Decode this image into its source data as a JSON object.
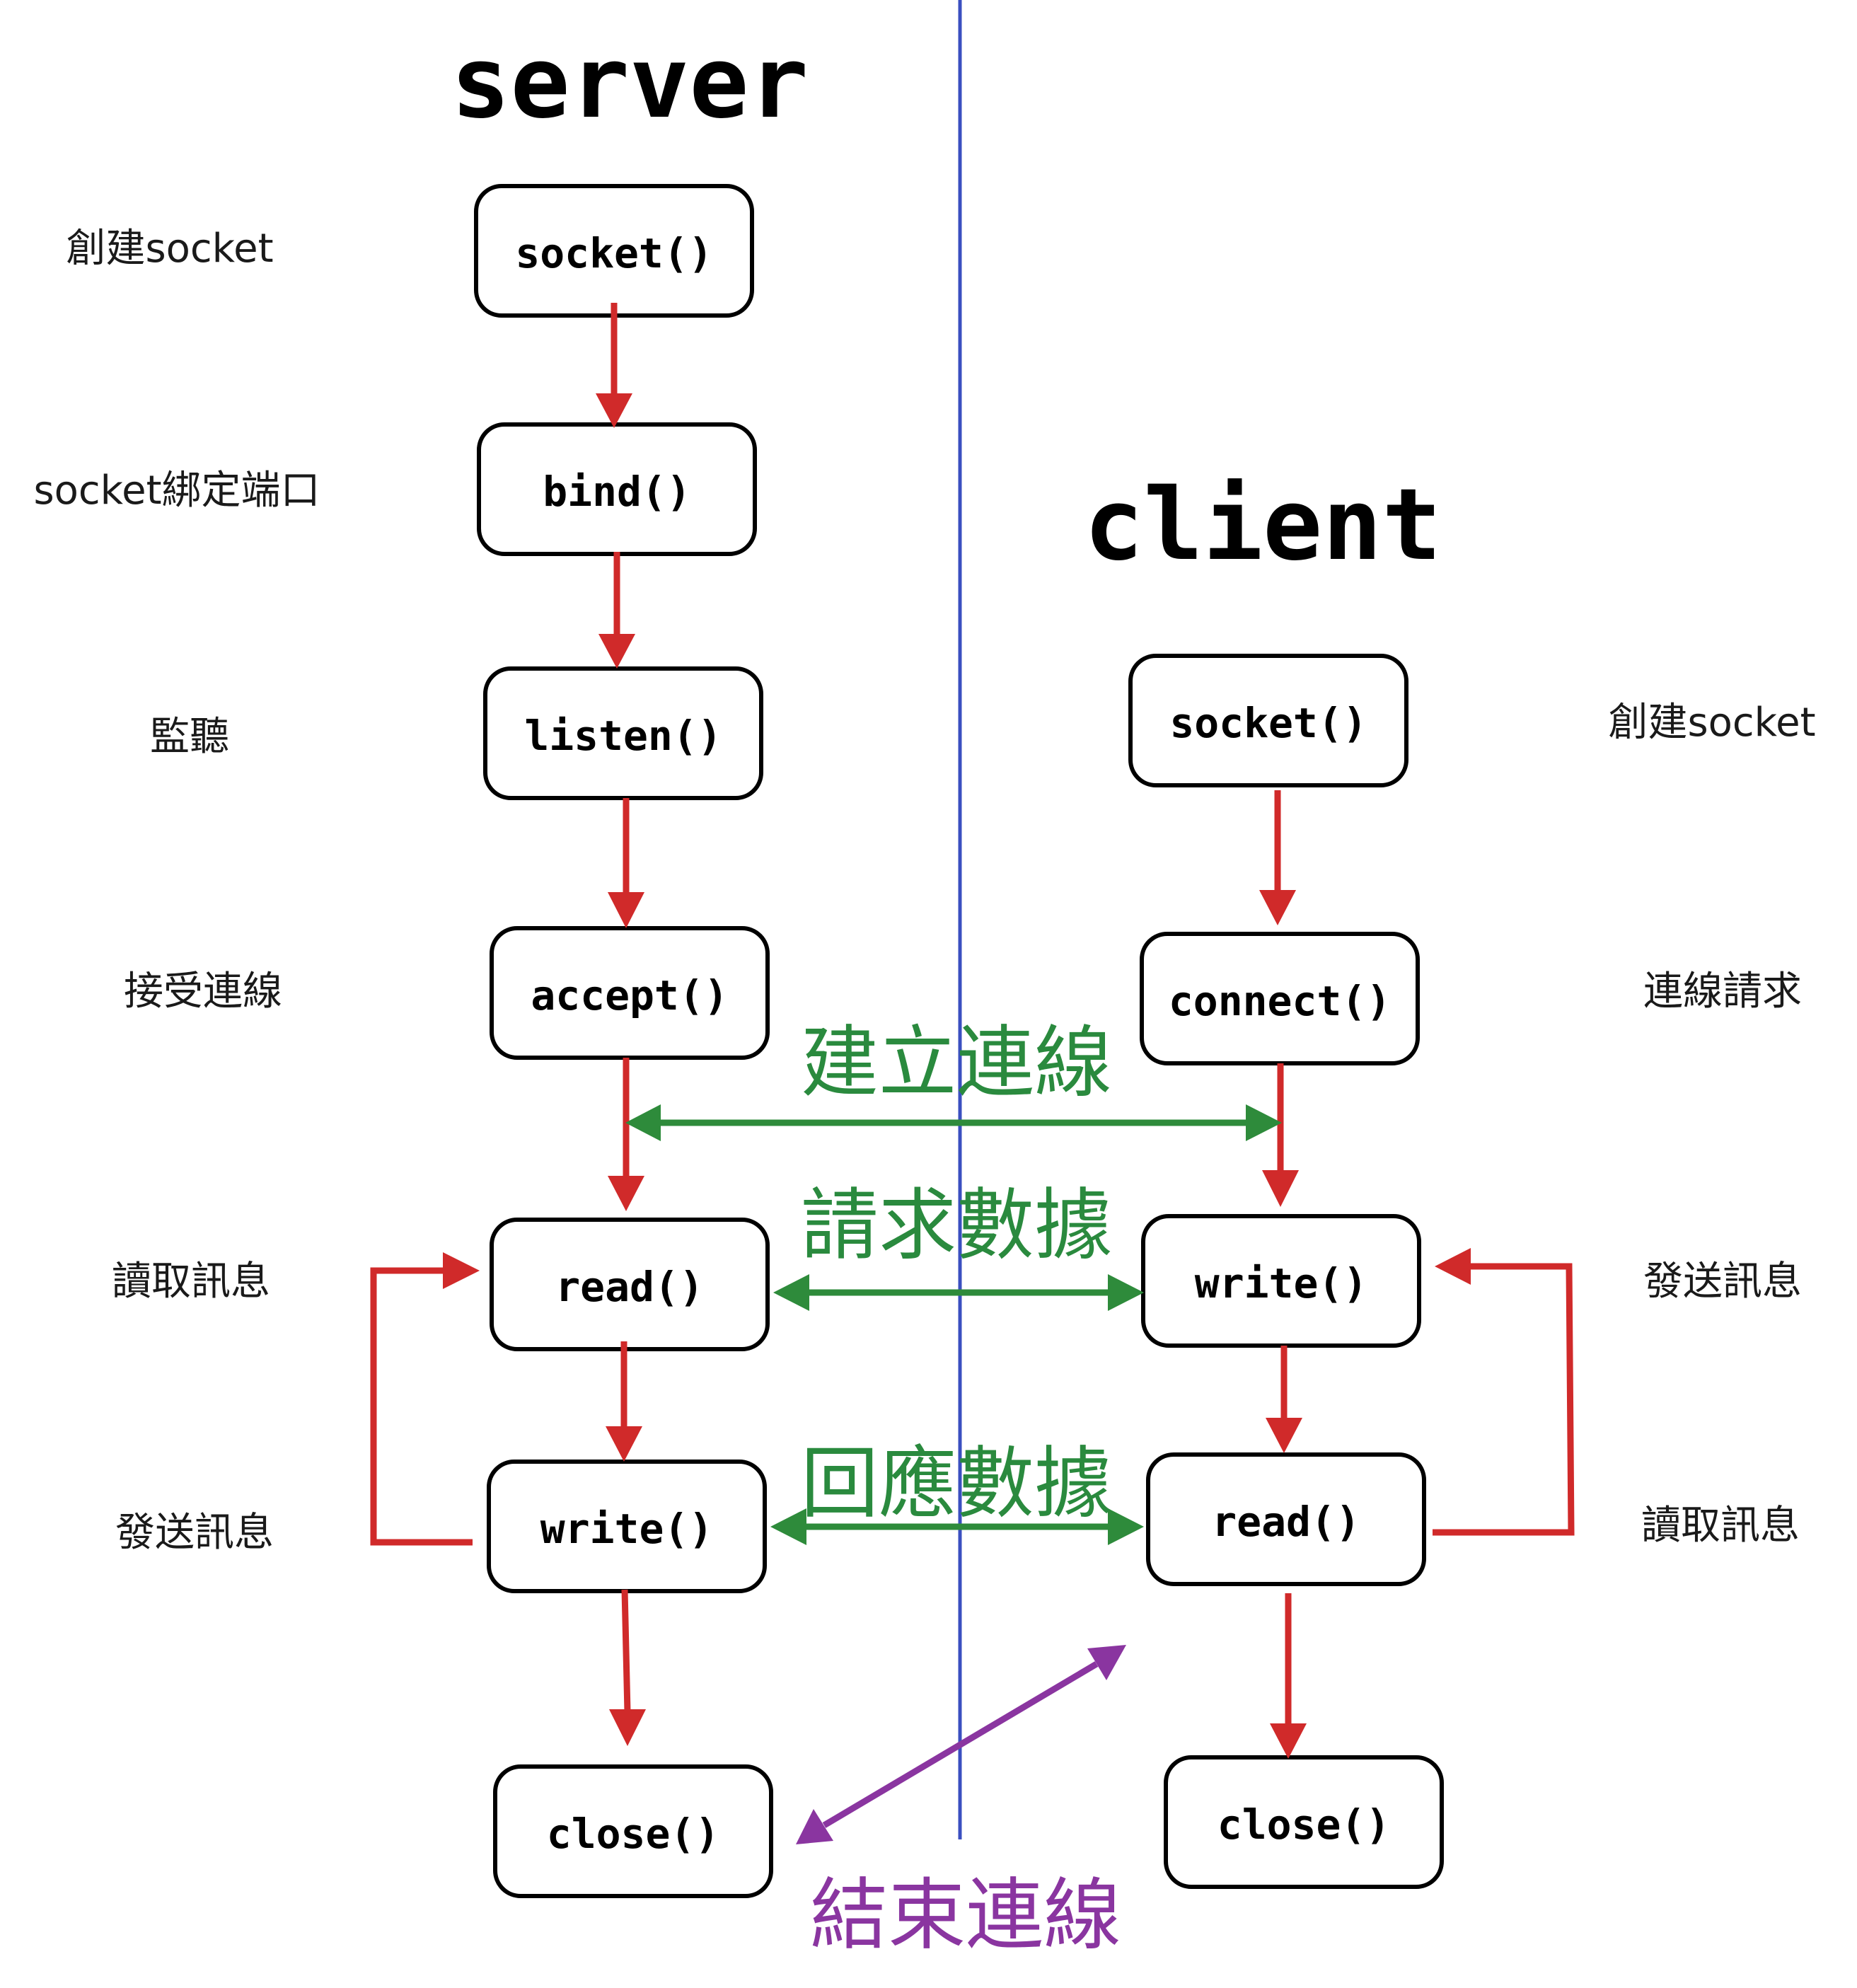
{
  "titles": {
    "server": "server",
    "client": "client"
  },
  "server": {
    "steps": [
      {
        "label": "socket()",
        "note": "創建socket"
      },
      {
        "label": "bind()",
        "note": "socket綁定端口"
      },
      {
        "label": "listen()",
        "note": "監聽"
      },
      {
        "label": "accept()",
        "note": "接受連線"
      },
      {
        "label": "read()",
        "note": "讀取訊息"
      },
      {
        "label": "write()",
        "note": "發送訊息"
      },
      {
        "label": "close()",
        "note": ""
      }
    ]
  },
  "client": {
    "steps": [
      {
        "label": "socket()",
        "note": "創建socket"
      },
      {
        "label": "connect()",
        "note": "連線請求"
      },
      {
        "label": "write()",
        "note": "發送訊息"
      },
      {
        "label": "read()",
        "note": "讀取訊息"
      },
      {
        "label": "close()",
        "note": ""
      }
    ]
  },
  "links": {
    "connect": "建立連線",
    "request": "請求數據",
    "response": "回應數據",
    "close": "結束連線"
  },
  "colors": {
    "flow": "#d02a2a",
    "exchange": "#2e8b3b",
    "close_link": "#8a35a0",
    "divider": "#3a4fc0"
  }
}
